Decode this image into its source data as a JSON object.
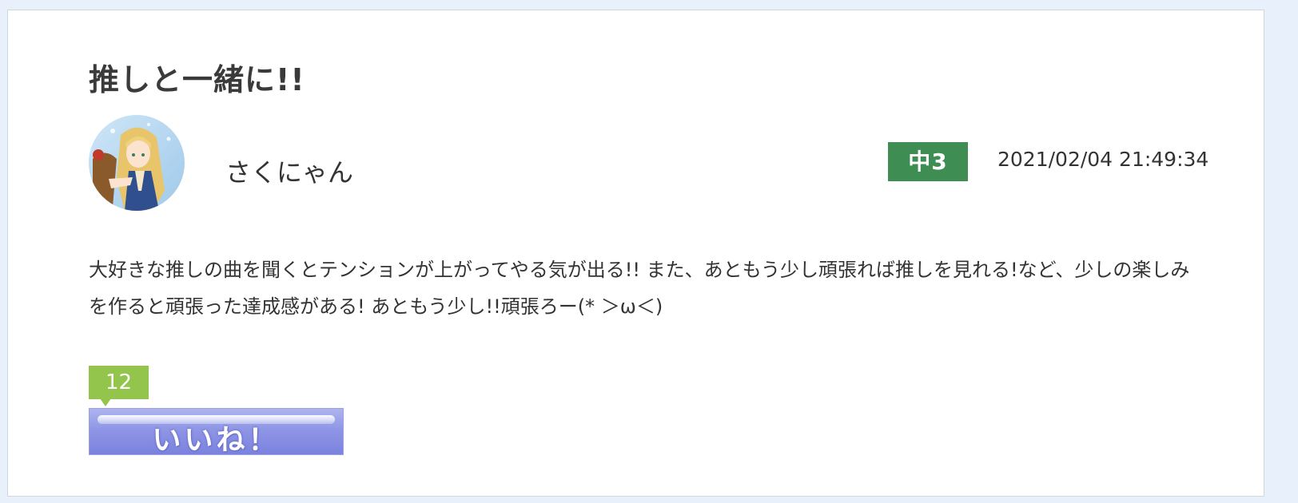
{
  "post": {
    "title": "推しと一緒に!!",
    "author": {
      "name": "さくにゃん",
      "avatar_icon": "anime-girl-avatar-icon"
    },
    "grade": "中3",
    "timestamp": "2021/02/04 21:49:34",
    "body": "大好きな推しの曲を聞くとテンションが上がってやる気が出る!! また、あともう少し頑張れば推しを見れる!など、少しの楽しみを作ると頑張った達成感がある! あともう少し!!頑張ろー(* ＞ω＜)",
    "likes": {
      "count": "12",
      "button_label": "いいね！"
    }
  },
  "colors": {
    "page_background": "#e8f1fb",
    "card_background": "#ffffff",
    "grade_badge": "#3e8e54",
    "like_count_badge": "#93c54c",
    "like_button": "#8f96e6"
  }
}
